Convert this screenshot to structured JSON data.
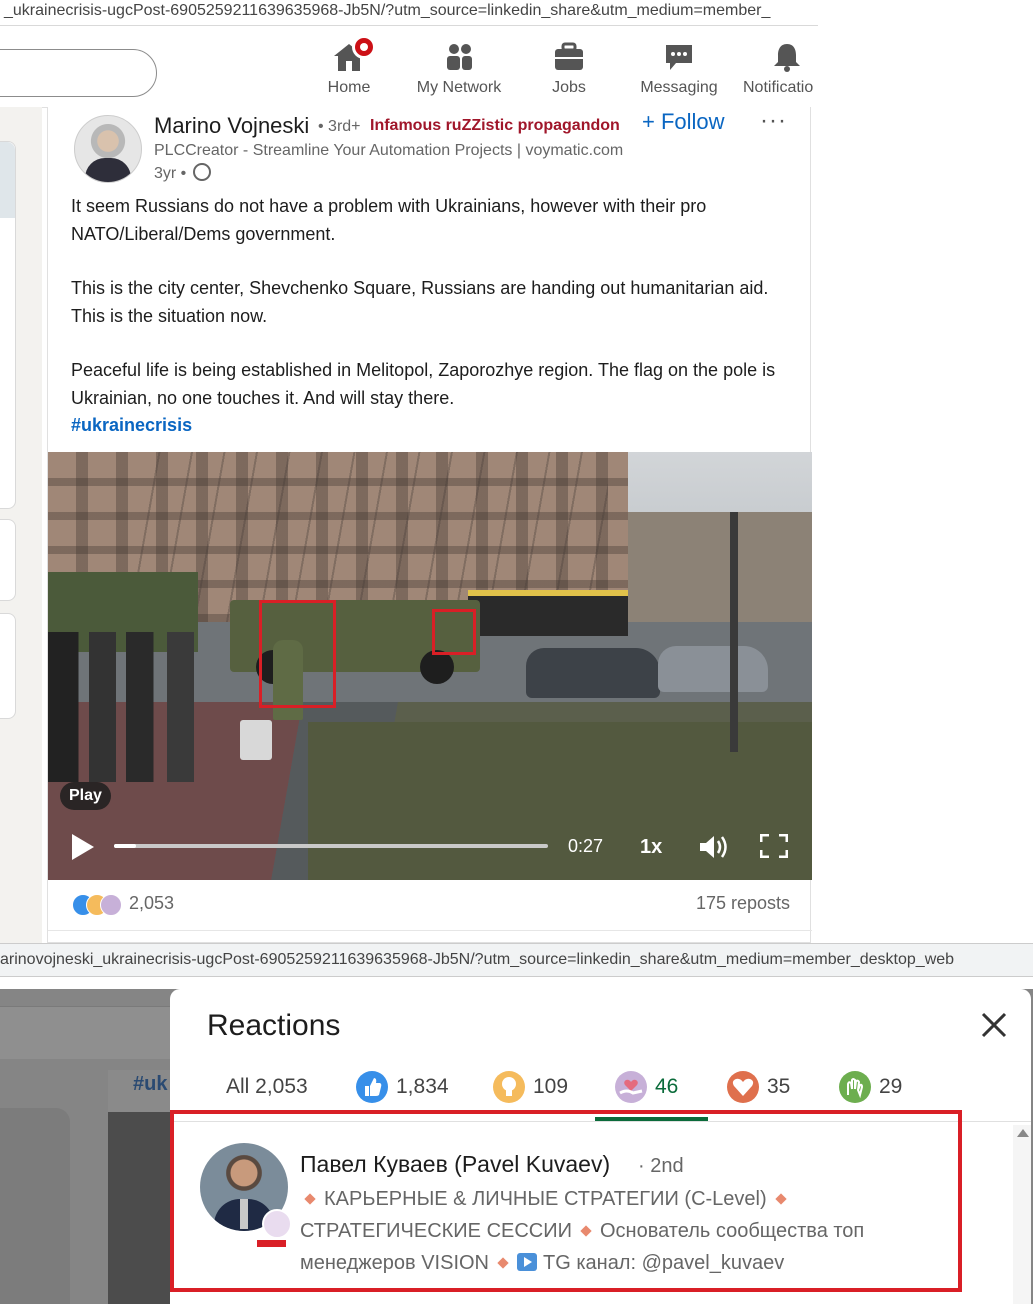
{
  "browser": {
    "url_top": "_ukrainecrisis-ugcPost-6905259211639635968-Jb5N/?utm_source=linkedin_share&utm_medium=member_",
    "url_bottom": "arinovojneski_ukrainecrisis-ugcPost-6905259211639635968-Jb5N/?utm_source=linkedin_share&utm_medium=member_desktop_web"
  },
  "nav": {
    "items": [
      {
        "label": "Home",
        "icon": "home-icon"
      },
      {
        "label": "My Network",
        "icon": "network-icon"
      },
      {
        "label": "Jobs",
        "icon": "briefcase-icon"
      },
      {
        "label": "Messaging",
        "icon": "chat-icon"
      },
      {
        "label": "Notificatio",
        "icon": "bell-icon"
      }
    ]
  },
  "post": {
    "author": {
      "name": "Marino Vojneski",
      "degree": "• 3rd+",
      "tag": "Infamous ruZZistic propagandon",
      "headline": "PLCCreator - Streamline Your Automation Projects | voymatic.com",
      "time": "3yr •"
    },
    "follow_label": "+ Follow",
    "more_label": "···",
    "paragraphs": [
      "It seem Russians do not have a problem with Ukrainians, however with their pro NATO/Liberal/Dems government.",
      "This is the city center, Shevchenko Square, Russians are handing out humanitarian aid. This is the situation now.",
      "Peaceful life is being established in Melitopol, Zaporozhye region. The flag on the pole is Ukrainian, no one touches it. And will stay there."
    ],
    "hashtag": "#ukrainecrisis",
    "video": {
      "play_tooltip": "Play",
      "time": "0:27",
      "speed": "1x",
      "progress": 0.05
    },
    "reactions_count": "2,053",
    "reposts": "175 reposts"
  },
  "background": {
    "hashtag_fragment": "#uk"
  },
  "reactions_modal": {
    "title": "Reactions",
    "tabs": [
      {
        "label": "All 2,053",
        "icon": null
      },
      {
        "label": "1,834",
        "icon": "like-icon"
      },
      {
        "label": "109",
        "icon": "insightful-icon"
      },
      {
        "label": "46",
        "icon": "support-icon"
      },
      {
        "label": "35",
        "icon": "love-icon"
      },
      {
        "label": "29",
        "icon": "celebrate-icon"
      }
    ],
    "active_tab": 3,
    "person": {
      "name": "Павел Куваев (Pavel Kuvaev)",
      "degree": "· 2nd",
      "headline_parts": [
        "КАРЬЕРНЫЕ & ЛИЧНЫЕ СТРАТЕГИИ (C-Level)",
        "СТРАТЕГИЧЕСКИЕ СЕССИИ",
        "Основатель сообщества топ менеджеров VISION",
        "TG канал: @pavel_kuvaev"
      ]
    }
  },
  "colors": {
    "brand_blue": "#0a66c2",
    "tag_red": "#a0162a",
    "highlight_red": "#d91f26",
    "active_green": "#0a6b3a"
  }
}
